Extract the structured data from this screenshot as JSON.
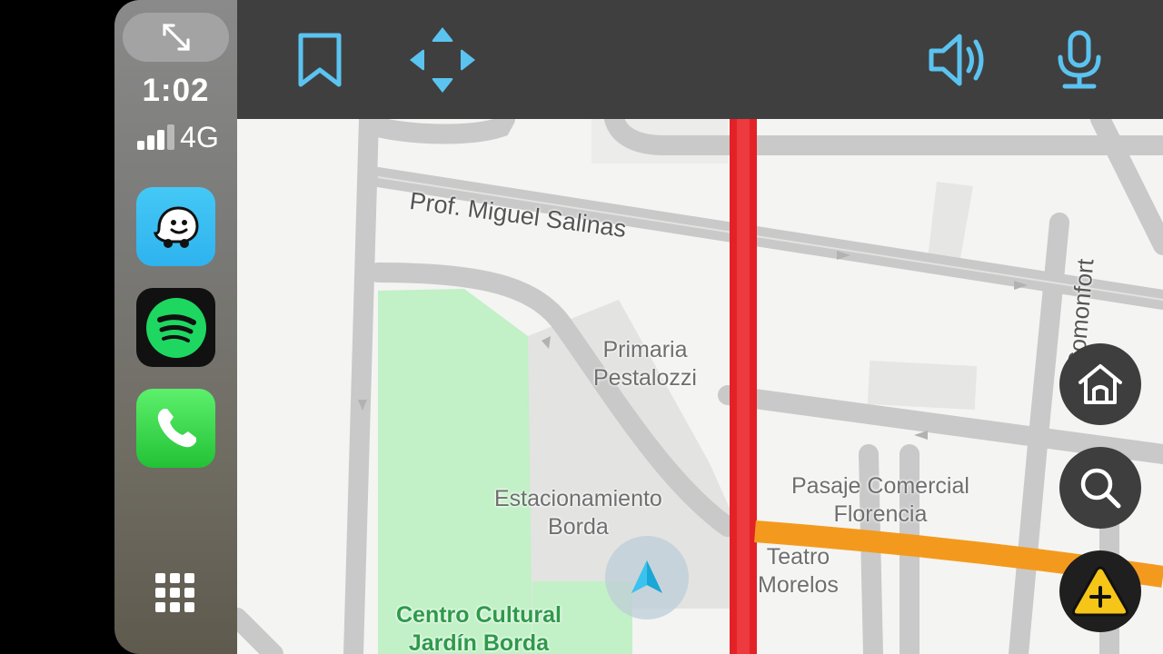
{
  "status": {
    "time": "1:02",
    "network": "4G",
    "signal_bars": 3,
    "signal_max": 4
  },
  "dock": {
    "apps": [
      {
        "name": "Waze",
        "icon": "waze-icon",
        "color": "#33bdf2"
      },
      {
        "name": "Spotify",
        "icon": "spotify-icon",
        "color": "#1ed760"
      },
      {
        "name": "Phone",
        "icon": "phone-icon",
        "color": "#34d04a"
      }
    ],
    "expand_icon": "expand-icon",
    "app_grid_icon": "app-grid-icon"
  },
  "toolbar": {
    "icons": [
      "bookmark-icon",
      "pan-arrows-icon",
      "volume-icon",
      "microphone-icon"
    ],
    "accent": "#5bc3f0"
  },
  "map": {
    "streets": {
      "prof_miguel_salinas": "Prof. Miguel Salinas",
      "comonfort": "Comonfort"
    },
    "places": {
      "primaria_1": "Primaria",
      "primaria_2": "Pestalozzi",
      "estacionamiento_1": "Estacionamiento",
      "estacionamiento_2": "Borda",
      "pasaje_1": "Pasaje Comercial",
      "pasaje_2": "Florencia",
      "teatro_1": "Teatro",
      "teatro_2": "Morelos",
      "centro_1": "Centro Cultural",
      "centro_2": "Jardín Borda"
    },
    "traffic_colors": {
      "heavy": "#e32227",
      "moderate": "#f39a1e"
    }
  },
  "actions": {
    "home_icon": "home-icon",
    "search_icon": "search-icon",
    "report_icon": "report-hazard-icon",
    "report_color": "#f5c518"
  }
}
